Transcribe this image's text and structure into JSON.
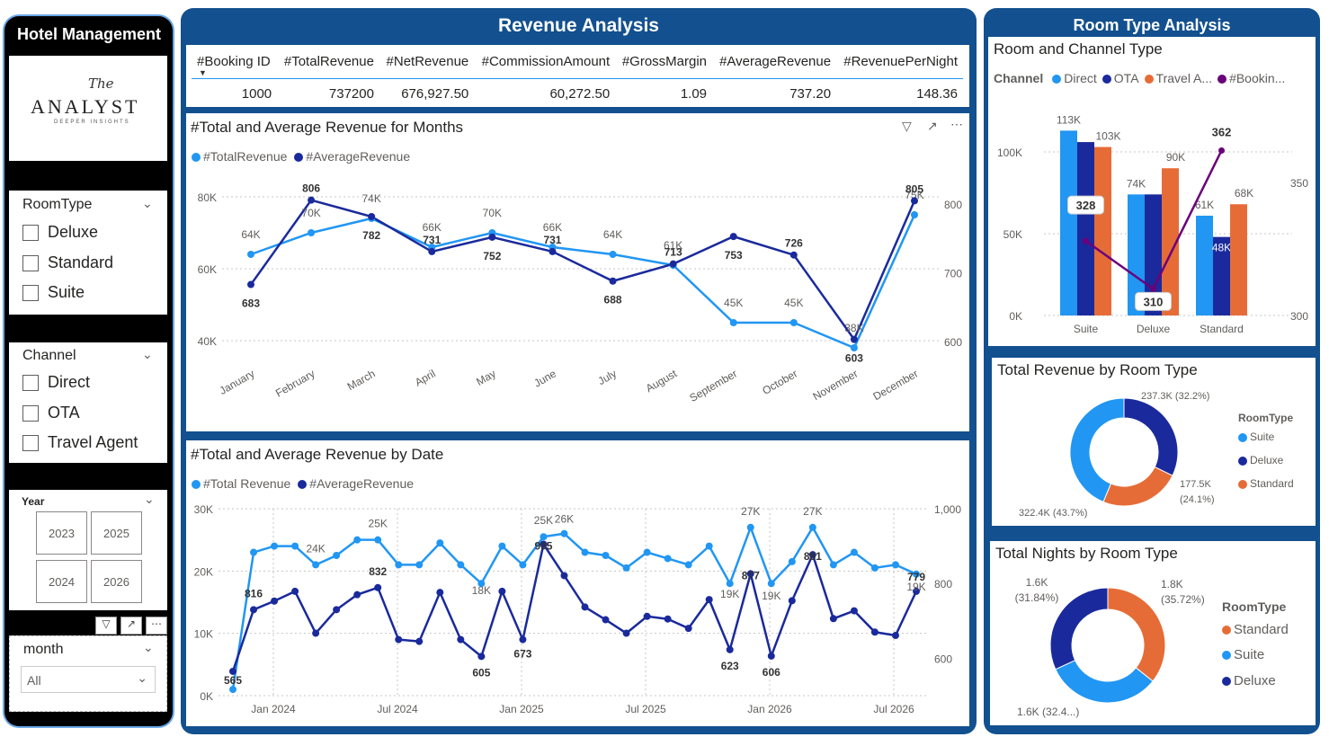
{
  "sidebar": {
    "title": "Hotel Management",
    "logo": {
      "script": "The",
      "word": "ANALYST",
      "tag": "DEEPER INSIGHTS"
    },
    "roomtype": {
      "title": "RoomType",
      "options": [
        "Deluxe",
        "Standard",
        "Suite"
      ]
    },
    "channel": {
      "title": "Channel",
      "options": [
        "Direct",
        "OTA",
        "Travel Agent"
      ]
    },
    "year": {
      "title": "Year",
      "tiles": [
        "2023",
        "2025",
        "2024",
        "2026"
      ]
    },
    "month": {
      "title": "month",
      "value": "All"
    }
  },
  "revenue": {
    "header": "Revenue Analysis",
    "table": {
      "headers": [
        "#Booking ID",
        "#TotalRevenue",
        "#NetRevenue",
        "#CommissionAmount",
        "#GrossMargin",
        "#AverageRevenue",
        "#RevenuePerNight"
      ],
      "row": [
        "1000",
        "737200",
        "676,927.50",
        "60,272.50",
        "1.09",
        "737.20",
        "148.36"
      ]
    }
  },
  "monthly": {
    "title": "#Total and Average Revenue for Months",
    "legend": [
      "#TotalRevenue",
      "#AverageRevenue"
    ],
    "colors": {
      "total": "#2196f3",
      "avg": "#1a2a9c"
    },
    "chart_data": {
      "type": "line",
      "categories": [
        "January",
        "February",
        "March",
        "April",
        "May",
        "June",
        "July",
        "August",
        "September",
        "October",
        "November",
        "December"
      ],
      "series": [
        {
          "name": "#TotalRevenue",
          "axis": "left",
          "values": [
            64,
            70,
            74,
            66,
            70,
            66,
            64,
            61,
            45,
            45,
            38,
            75
          ],
          "labels": [
            "64K",
            "70K",
            "74K",
            "66K",
            "70K",
            "66K",
            "64K",
            "61K",
            "45K",
            "45K",
            "38K",
            "75K"
          ]
        },
        {
          "name": "#AverageRevenue",
          "axis": "right",
          "values": [
            683,
            806,
            782,
            731,
            752,
            731,
            688,
            713,
            753,
            726,
            603,
            805
          ]
        }
      ],
      "y_left": {
        "ticks": [
          "40K",
          "60K",
          "80K"
        ],
        "range": [
          35,
          85
        ]
      },
      "y_right": {
        "ticks": [
          "600",
          "700",
          "800"
        ],
        "range": [
          575,
          837
        ]
      }
    }
  },
  "daily": {
    "title": "#Total and Average Revenue by Date",
    "legend": [
      "#Total Revenue",
      "#AverageRevenue"
    ],
    "chart_data": {
      "type": "line",
      "x_ticks": [
        "Jan 2024",
        "Jul 2024",
        "Jan 2025",
        "Jul 2025",
        "Jan 2026",
        "Jul 2026"
      ],
      "series": [
        {
          "name": "#Total Revenue",
          "axis": "left",
          "values": [
            1,
            23,
            24,
            24,
            21,
            22.5,
            25,
            25,
            21,
            21,
            24.5,
            21,
            18,
            24,
            21,
            25.5,
            26,
            23,
            22.5,
            20.5,
            23,
            22,
            21,
            24,
            18,
            27,
            18,
            21.5,
            27,
            21,
            23,
            20.5,
            21,
            19.5
          ]
        },
        {
          "name": "#AverageRevenue",
          "axis": "right",
          "values": [
            565,
            730,
            753,
            779,
            667,
            730,
            770,
            789,
            650,
            645,
            776,
            650,
            605,
            779,
            650,
            905,
            821,
            737,
            703,
            667,
            712,
            705,
            680,
            757,
            623,
            826,
            606,
            754,
            877,
            706,
            727,
            670,
            661,
            779
          ]
        }
      ],
      "labels": [
        "565",
        "24K",
        "816",
        "25K",
        "832",
        "18K",
        "605",
        "673",
        "25K",
        "905",
        "26K",
        "623",
        "19K",
        "27K",
        "877",
        "606",
        "19K",
        "27K",
        "881",
        "779",
        "19K"
      ],
      "y_left": {
        "ticks": [
          "0K",
          "10K",
          "20K",
          "30K"
        ],
        "range": [
          0,
          30
        ]
      },
      "y_right": {
        "ticks": [
          "600",
          "800",
          "1,000"
        ],
        "range": [
          500,
          1000
        ]
      }
    }
  },
  "roomtype": {
    "header": "Room Type Analysis",
    "channel_chart": {
      "title": "Room and Channel Type",
      "legend_title": "Channel",
      "legend": [
        "Direct",
        "OTA",
        "Travel A...",
        "#Bookin..."
      ],
      "colors": {
        "direct": "#2196f3",
        "ota": "#1a2a9c",
        "travel": "#e66c37",
        "booking": "#6b007b"
      },
      "chart_data": {
        "type": "bar",
        "categories": [
          "Suite",
          "Deluxe",
          "Standard"
        ],
        "series": [
          {
            "name": "Direct",
            "values": [
              113,
              74,
              61
            ],
            "labels": [
              "113K",
              "74K",
              "61K"
            ]
          },
          {
            "name": "OTA",
            "values": [
              106,
              74,
              48
            ],
            "labels": [
              "",
              "",
              "48K"
            ]
          },
          {
            "name": "Travel A...",
            "values": [
              103,
              90,
              68
            ],
            "labels": [
              "103K",
              "90K",
              "68K"
            ]
          },
          {
            "name": "#Bookin...",
            "type": "line",
            "values": [
              328,
              310,
              362
            ]
          }
        ],
        "y_left": {
          "ticks": [
            "0K",
            "50K",
            "100K"
          ]
        },
        "y_right": {
          "ticks": [
            "300",
            "350"
          ]
        }
      }
    },
    "revenue_donut": {
      "title": "Total Revenue by Room Type",
      "legend_title": "RoomType",
      "legend": [
        "Suite",
        "Deluxe",
        "Standard"
      ],
      "chart_data": {
        "type": "pie",
        "slices": [
          {
            "name": "Suite",
            "value": 322.4,
            "label": "322.4K (43.7%)"
          },
          {
            "name": "Deluxe",
            "value": 237.3,
            "label": "237.3K (32.2%)"
          },
          {
            "name": "Standard",
            "value": 177.5,
            "label": "177.5K (24.1%)"
          }
        ]
      }
    },
    "nights_donut": {
      "title": "Total Nights by Room Type",
      "legend_title": "RoomType",
      "legend": [
        "Standard",
        "Suite",
        "Deluxe"
      ],
      "chart_data": {
        "type": "pie",
        "slices": [
          {
            "name": "Standard",
            "value": 35.72,
            "label": "1.8K (35.72%)"
          },
          {
            "name": "Suite",
            "value": 32.44,
            "label": "1.6K (32.4...)"
          },
          {
            "name": "Deluxe",
            "value": 31.84,
            "label": "1.6K (31.84%)"
          }
        ]
      }
    }
  }
}
